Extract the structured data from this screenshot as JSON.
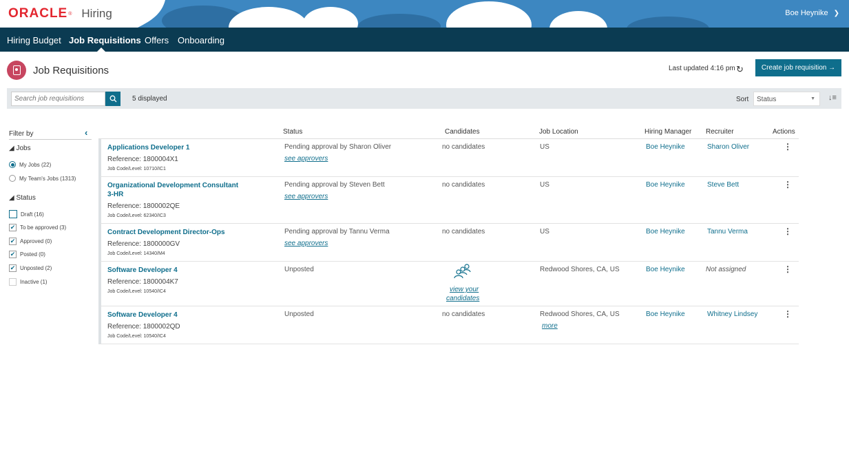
{
  "header": {
    "logo": "ORACLE",
    "app_name": "Hiring",
    "user_name": "Boe Heynike"
  },
  "nav": {
    "items": [
      {
        "label": "Hiring Budget"
      },
      {
        "label": "Job Requisitions"
      },
      {
        "label": "Offers"
      },
      {
        "label": "Onboarding"
      }
    ]
  },
  "page": {
    "title": "Job Requisitions",
    "last_updated": "Last updated 4:16 pm",
    "create_label": "Create job requisition →"
  },
  "toolbar": {
    "search_placeholder": "Search job requisitions",
    "displayed": "5 displayed",
    "sort_label": "Sort",
    "sort_value": "Status"
  },
  "filter": {
    "title": "Filter by",
    "jobs_label": "Jobs",
    "jobs_options": [
      {
        "label": "My Jobs (22)",
        "selected": true
      },
      {
        "label": "My Team's Jobs (1313)",
        "selected": false
      }
    ],
    "status_label": "Status",
    "status_options": [
      {
        "label": "Draft (16)",
        "checked": false
      },
      {
        "label": "To be approved (3)",
        "checked": true
      },
      {
        "label": "Approved (0)",
        "checked": true
      },
      {
        "label": "Posted (0)",
        "checked": true
      },
      {
        "label": "Unposted (2)",
        "checked": true
      },
      {
        "label": "Inactive (1)",
        "checked": false
      }
    ]
  },
  "table": {
    "headers": {
      "status": "Status",
      "candidates": "Candidates",
      "location": "Job Location",
      "manager": "Hiring Manager",
      "recruiter": "Recruiter",
      "actions": "Actions"
    },
    "rows": [
      {
        "title": "Applications Developer 1",
        "reference": "Reference: 1800004X1",
        "code": "Job Code/Level: 10710/IC1",
        "status": "Pending approval by Sharon Oliver",
        "status_link": "see approvers",
        "candidates": "no candidates",
        "location": "US",
        "manager": "Boe Heynike",
        "recruiter": "Sharon Oliver"
      },
      {
        "title": "Organizational Development Consultant 3-HR",
        "reference": "Reference: 1800002QE",
        "code": "Job Code/Level: 62340/IC3",
        "status": "Pending approval by Steven Bett",
        "status_link": "see approvers",
        "candidates": "no candidates",
        "location": "US",
        "manager": "Boe Heynike",
        "recruiter": "Steve Bett"
      },
      {
        "title": "Contract Development Director-Ops",
        "reference": "Reference: 1800000GV",
        "code": "Job Code/Level: 14340/M4",
        "status": "Pending approval by Tannu Verma",
        "status_link": "see approvers",
        "candidates": "no candidates",
        "location": "US",
        "manager": "Boe Heynike",
        "recruiter": "Tannu Verma"
      },
      {
        "title": "Software Developer 4",
        "reference": "Reference: 1800004K7",
        "code": "Job Code/Level: 10540/IC4",
        "status": "Unposted",
        "candidates_link_1": "view your",
        "candidates_link_2": "candidates",
        "location": "Redwood Shores, CA, US",
        "manager": "Boe Heynike",
        "recruiter": "Not assigned"
      },
      {
        "title": "Software Developer 4",
        "reference": "Reference: 1800002QD",
        "code": "Job Code/Level: 10540/IC4",
        "status": "Unposted",
        "candidates": "no candidates",
        "location": "Redwood Shores, CA, US",
        "location_link": "more",
        "manager": "Boe Heynike",
        "recruiter": "Whitney Lindsey"
      }
    ]
  },
  "colors": {
    "nav_bg": "#0b3b52",
    "accent": "#0f6e8c",
    "brand_red": "#e3262f",
    "sky": "#3d87c1"
  }
}
